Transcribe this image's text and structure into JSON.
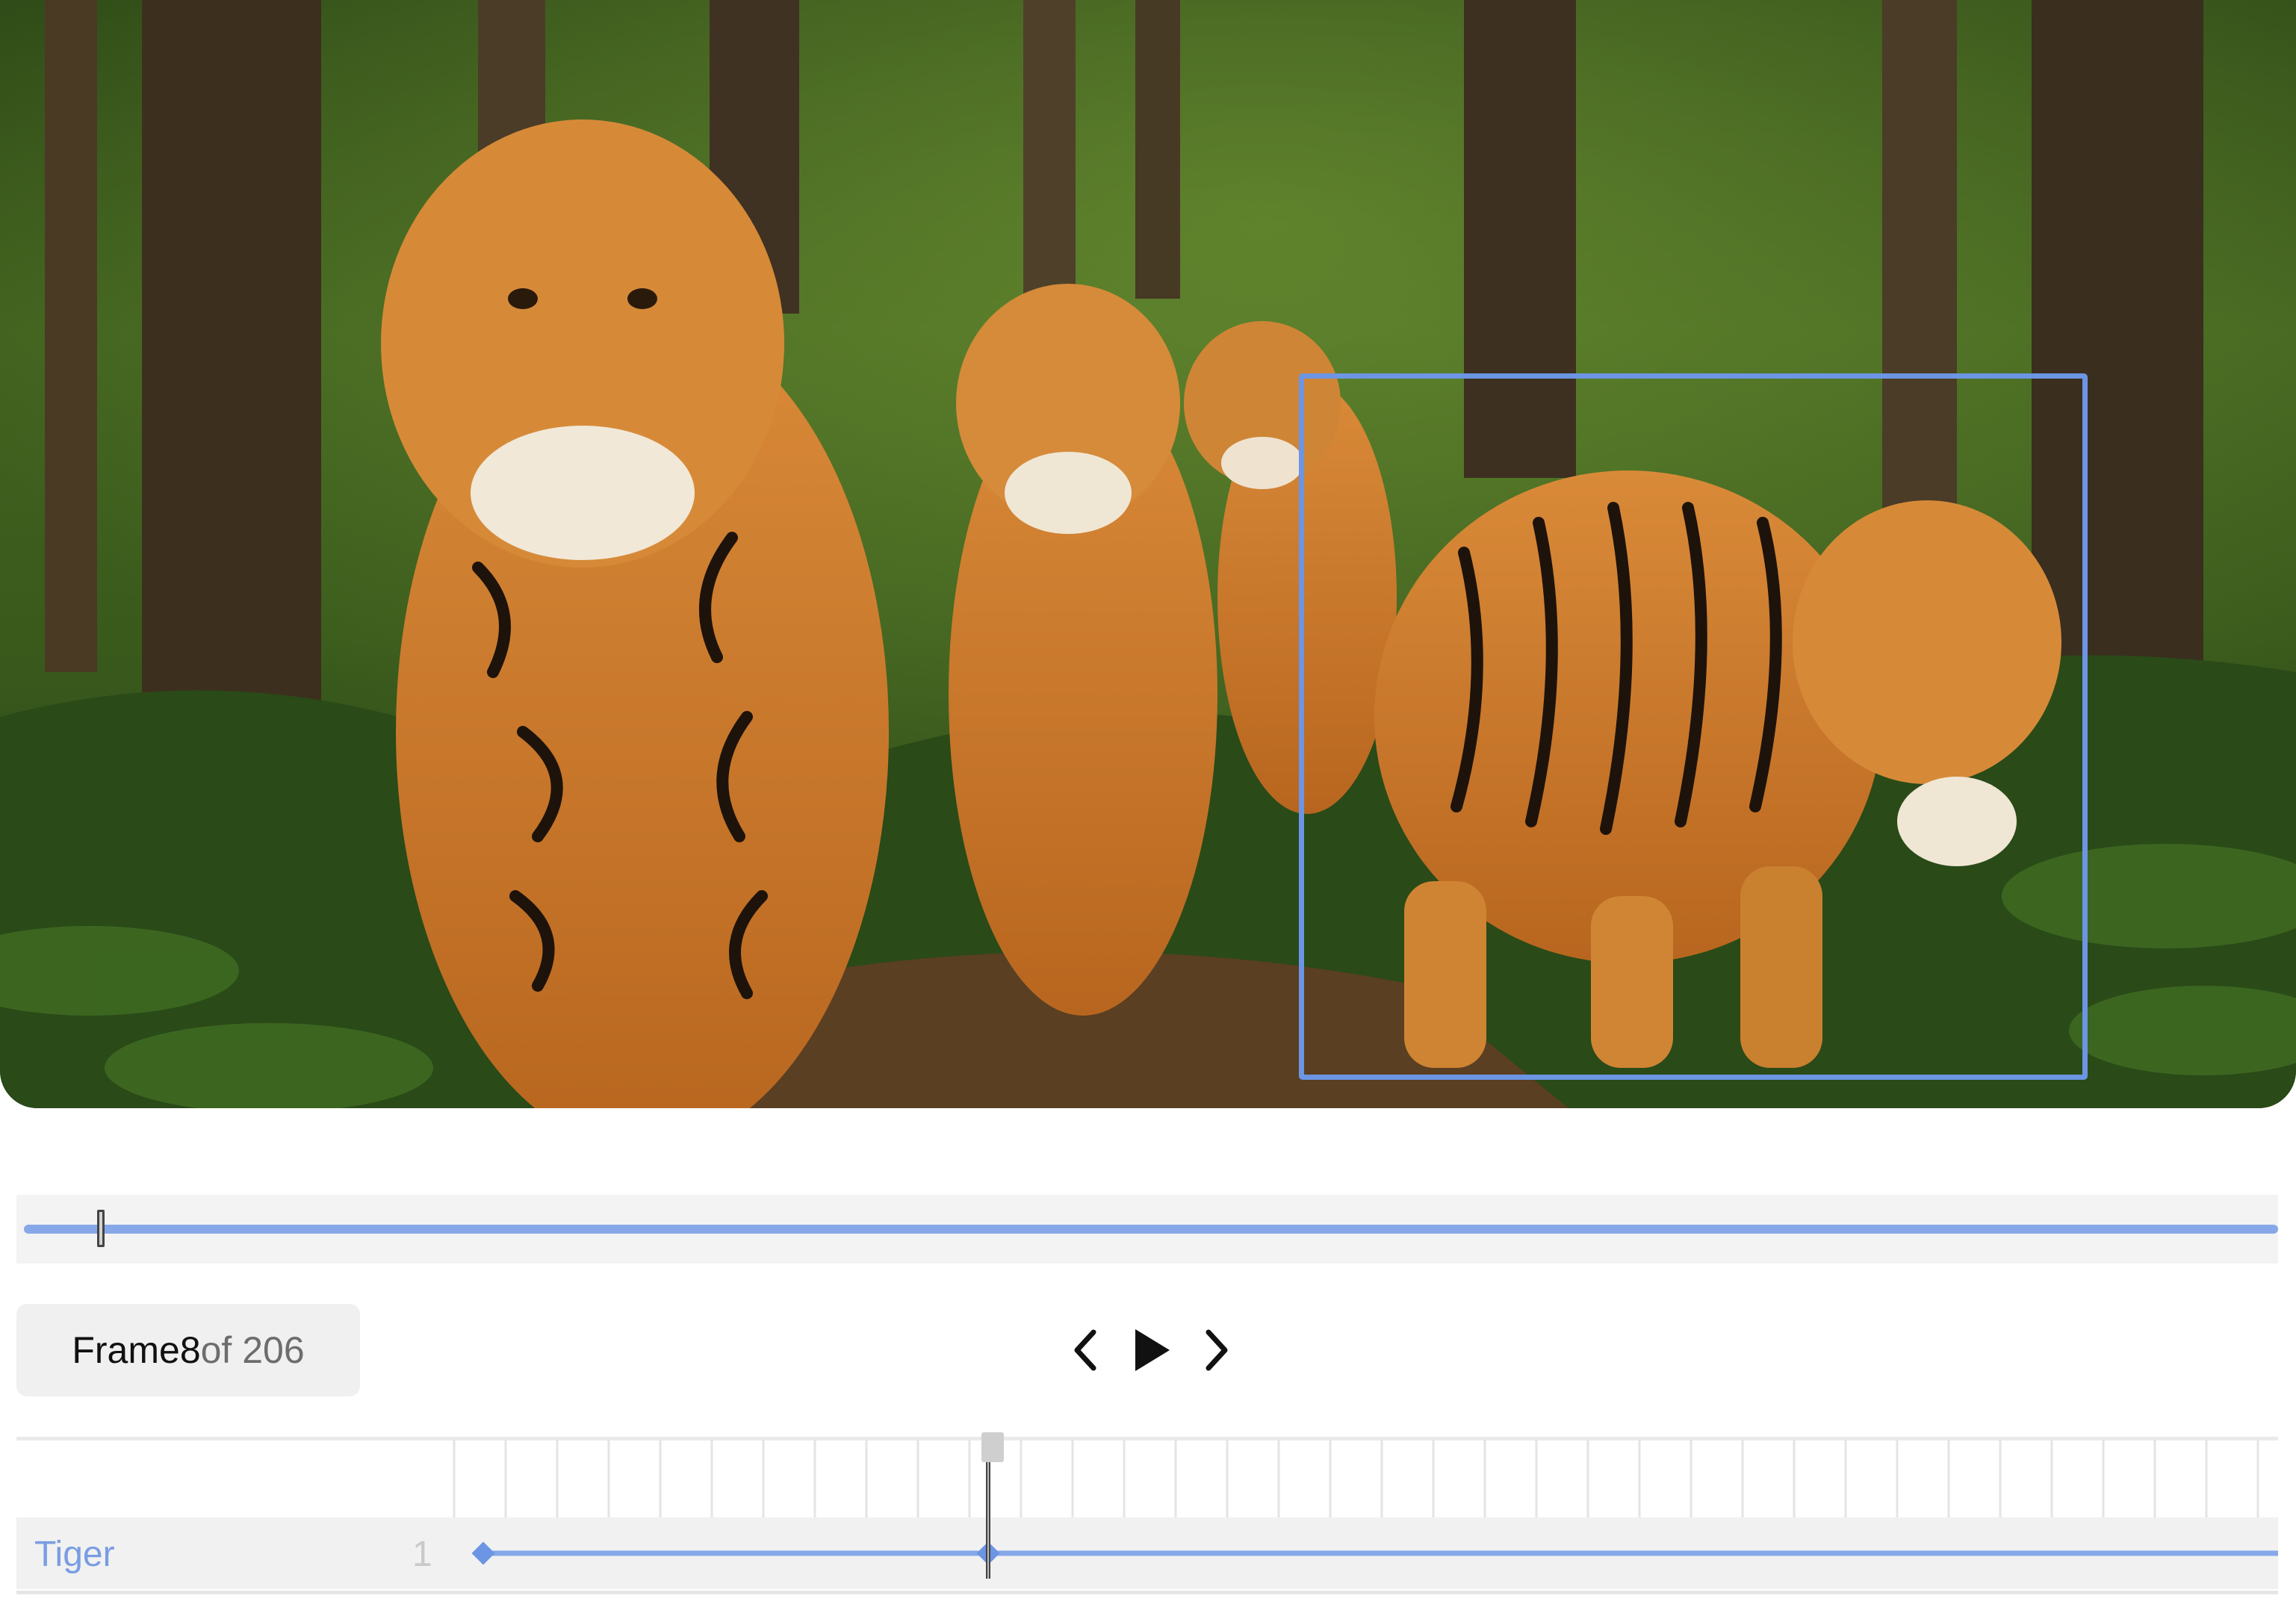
{
  "frame": {
    "label": "Frame",
    "current": "8",
    "of_text": "of 206"
  },
  "controls": {
    "prev": "chevron-left-icon",
    "play": "play-icon",
    "next": "chevron-right-icon"
  },
  "playback_progress": 0.034,
  "track": {
    "label": "Tiger",
    "id": "1"
  },
  "colors": {
    "accent": "#6c95e3",
    "track": "#86a8e8",
    "panel": "#f1f1f2"
  }
}
